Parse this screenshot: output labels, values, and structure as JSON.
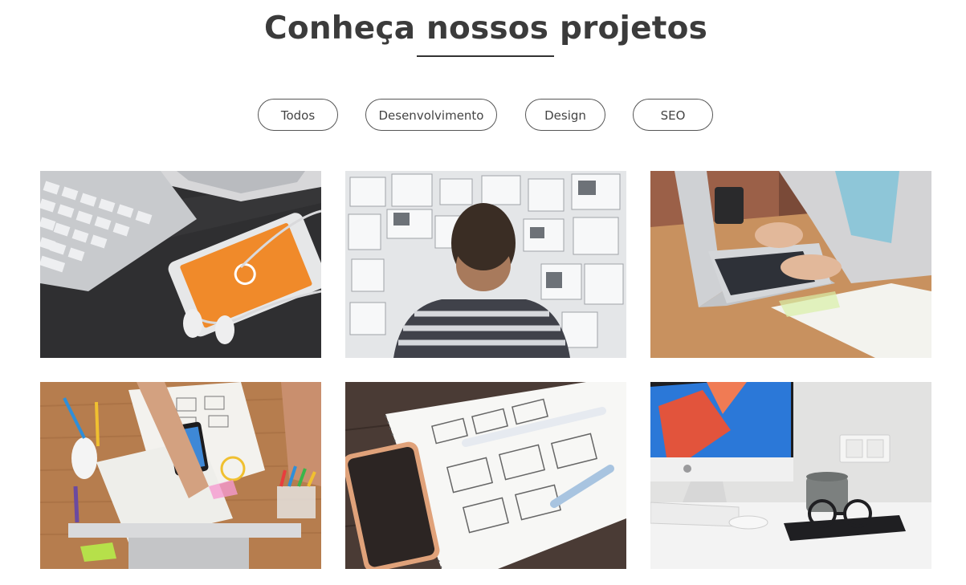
{
  "section": {
    "title": "Conheça nossos projetos"
  },
  "filters": [
    {
      "label": "Todos"
    },
    {
      "label": "Desenvolvimento"
    },
    {
      "label": "Design"
    },
    {
      "label": "SEO"
    }
  ],
  "projects": [
    {
      "icon": "phone-keyboard-photo"
    },
    {
      "icon": "moodboard-wall-photo"
    },
    {
      "icon": "laptop-typing-photo"
    },
    {
      "icon": "sketching-desk-photo"
    },
    {
      "icon": "wireframe-notebook-photo"
    },
    {
      "icon": "imac-desk-photo"
    }
  ]
}
